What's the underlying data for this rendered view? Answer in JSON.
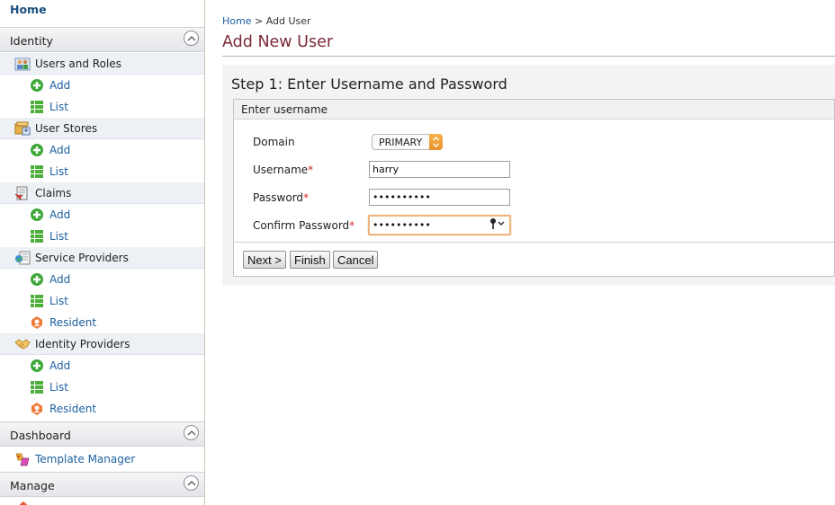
{
  "sidebar": {
    "home": "Home",
    "sections": {
      "identity": "Identity",
      "dashboard": "Dashboard",
      "manage": "Manage"
    },
    "identity": {
      "users_and_roles": {
        "label": "Users and Roles",
        "add": "Add",
        "list": "List"
      },
      "user_stores": {
        "label": "User Stores",
        "add": "Add",
        "list": "List"
      },
      "claims": {
        "label": "Claims",
        "add": "Add",
        "list": "List"
      },
      "service_providers": {
        "label": "Service Providers",
        "add": "Add",
        "list": "List",
        "resident": "Resident"
      },
      "identity_providers": {
        "label": "Identity Providers",
        "add": "Add",
        "list": "List",
        "resident": "Resident"
      }
    },
    "dashboard": {
      "template_manager": "Template Manager"
    }
  },
  "breadcrumb": {
    "home": "Home",
    "separator": ">",
    "current": "Add User"
  },
  "page_title": "Add New User",
  "step_title": "Step 1: Enter Username and Password",
  "form": {
    "section_title": "Enter username",
    "domain_label": "Domain",
    "domain_value": "PRIMARY",
    "username_label": "Username",
    "username_value": "harry",
    "password_label": "Password",
    "password_value": "••••••••••",
    "confirm_label": "Confirm Password",
    "confirm_value": "••••••••••",
    "required_mark": "*"
  },
  "buttons": {
    "next": "Next >",
    "finish": "Finish",
    "cancel": "Cancel"
  },
  "colors": {
    "title": "#7a2a36",
    "link": "#1b5f9e",
    "required": "#d8262a",
    "focus_ring": "#efb580",
    "select_arrow": "#e8902b"
  }
}
